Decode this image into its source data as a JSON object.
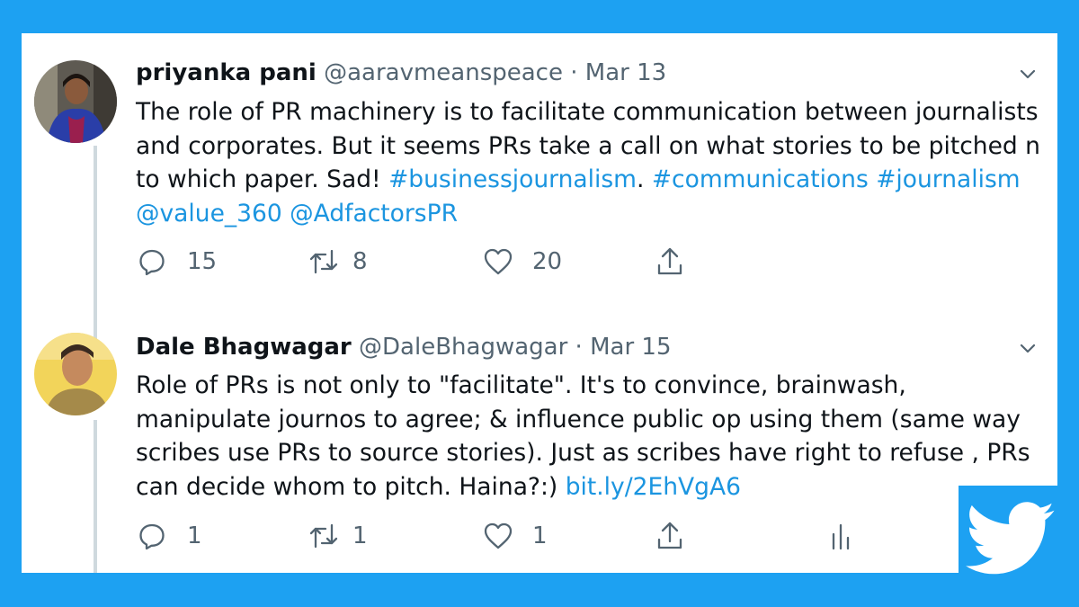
{
  "tweets": [
    {
      "author_name": "priyanka pani",
      "handle": "@aaravmeanspeace",
      "separator": "·",
      "date": "Mar 13",
      "text_plain_1": "The role of PR machinery is to facilitate communication between journalists and corporates. But it seems PRs take a call on what stories to be pitched n to which paper. Sad! ",
      "hashtag_business": "#businessjournalism",
      "text_plain_2": ". ",
      "hashtag_communications": "#communications",
      "hashtag_journalism": "#journalism",
      "mention_value": "@value_360",
      "mention_adfactors": "@AdfactorsPR",
      "replies": "15",
      "retweets": "8",
      "likes": "20"
    },
    {
      "author_name": "Dale Bhagwagar",
      "handle": "@DaleBhagwagar",
      "separator": "·",
      "date": "Mar 15",
      "text_plain": "Role of PRs is not only to \"facilitate\". It's to convince, brainwash, manipulate journos to agree; & influence public op using them (same way scribes use PRs to source stories). Just as scribes have right to refuse , PRs can decide whom to pitch. Haina?:) ",
      "link": "bit.ly/2EhVgA6",
      "replies": "1",
      "retweets": "1",
      "likes": "1"
    }
  ],
  "icons": {
    "reply": "reply-icon",
    "retweet": "retweet-icon",
    "like": "heart-icon",
    "share": "share-icon",
    "analytics": "analytics-icon",
    "more": "chevron-down-icon",
    "brand": "twitter-bird-icon"
  },
  "colors": {
    "background": "#1da1f2",
    "link": "#1b95e0",
    "text": "#0f1419",
    "secondary": "#536471"
  }
}
